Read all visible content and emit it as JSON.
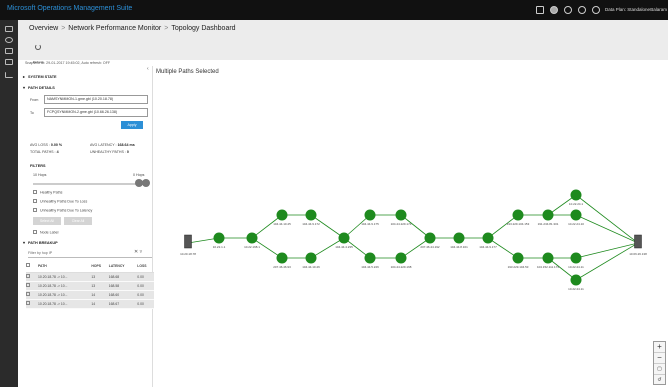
{
  "app": {
    "title": "Microsoft Operations Management Suite",
    "data_source": "Data Plan: Standalone",
    "user": "Balaram"
  },
  "breadcrumb": [
    "Overview",
    "Network Performance Monitor",
    "Topology Dashboard"
  ],
  "toolbar": {
    "refresh_label": "Refresh"
  },
  "snapshot_text": "Snapshot at: 29-01-2017 19:45:02, Auto refresh: OFF",
  "sections": {
    "system_state": "SYSTEM STATE",
    "path_details": "PATH DETAILS",
    "filters": "FILTERS",
    "path_breakup": "PATH BREAKUP"
  },
  "path": {
    "from_label": "From",
    "from_value": "NAMSYNMMON-1.gme.gbl (10.20.18.78)",
    "to_label": "To",
    "to_value": "FCPQSYNMMON-2.gme.gbl (10.66.26.138)",
    "apply": "Apply"
  },
  "stats": {
    "avg_loss_label": "AVG LOSS :",
    "avg_loss": "0.00 %",
    "avg_latency_label": "AVG LATENCY :",
    "avg_latency": "168.64 ms",
    "total_paths_label": "TOTAL PATHS :",
    "total_paths": "4",
    "unhealthy_label": "UNHEALTHY PATHS :",
    "unhealthy": "0"
  },
  "filters": {
    "hops_min": "10 Hops",
    "hops_max": "0 Hops",
    "options": [
      "Healthy Paths",
      "Unhealthy Paths Due To Loss",
      "Unhealthy Paths Due To Latency"
    ],
    "btn_left": "Select All",
    "btn_right": "Clear All",
    "node_label": "Node Label"
  },
  "breakup": {
    "filter_placeholder": "Filter by hop IP",
    "columns": [
      "PATH",
      "HOPS",
      "LATENCY",
      "LOSS"
    ],
    "rows": [
      {
        "path": "10.20.18.78 -> 10...",
        "hops": "13",
        "latency": "168.68",
        "loss": "0.00"
      },
      {
        "path": "10.20.18.78 -> 10...",
        "hops": "13",
        "latency": "168.58",
        "loss": "0.00"
      },
      {
        "path": "10.20.18.78 -> 10...",
        "hops": "14",
        "latency": "168.60",
        "loss": "0.00"
      },
      {
        "path": "10.20.18.78 -> 10...",
        "hops": "14",
        "latency": "168.67",
        "loss": "0.00"
      }
    ]
  },
  "canvas": {
    "title": "Multiple Paths Selected"
  },
  "topology": {
    "source": {
      "label": "10.20.18.78"
    },
    "dest": {
      "label": "10.66.26.138"
    },
    "nodes": [
      {
        "id": "n1",
        "label": "10.22.1.1"
      },
      {
        "id": "n2",
        "label": "10.22.168.1"
      },
      {
        "id": "n3",
        "label": "104.44.10.45"
      },
      {
        "id": "n4",
        "label": "104.44.9.172"
      },
      {
        "id": "n5",
        "label": "207.46.46.93"
      },
      {
        "id": "n6",
        "label": "104.44.10.46"
      },
      {
        "id": "n7",
        "label": "104.44.4.235"
      },
      {
        "id": "n8",
        "label": "104.44.9.175"
      },
      {
        "id": "n9",
        "label": "104.44.229.174"
      },
      {
        "id": "n10",
        "label": "104.44.5.246"
      },
      {
        "id": "n11",
        "label": "104.44.229.168"
      },
      {
        "id": "n12",
        "label": "207.46.44.192"
      },
      {
        "id": "n13",
        "label": "104.44.8.161"
      },
      {
        "id": "n14",
        "label": "104.44.9.177"
      },
      {
        "id": "n15",
        "label": "193.229.104.153"
      },
      {
        "id": "n16",
        "label": "191.234.81.301"
      },
      {
        "id": "n17",
        "label": "193.229.104.53"
      },
      {
        "id": "n18",
        "label": "104.152.111.174"
      },
      {
        "id": "n19",
        "label": "10.22.24.1"
      },
      {
        "id": "n20",
        "label": "10.22.24.10"
      },
      {
        "id": "n21",
        "label": "10.22.24.11"
      },
      {
        "id": "n22",
        "label": "10.22.24.11"
      }
    ],
    "edges": [
      [
        "src",
        "n1"
      ],
      [
        "n1",
        "n2"
      ],
      [
        "n2",
        "n3"
      ],
      [
        "n2",
        "n5"
      ],
      [
        "n3",
        "n4"
      ],
      [
        "n5",
        "n6"
      ],
      [
        "n4",
        "n7"
      ],
      [
        "n6",
        "n7"
      ],
      [
        "n7",
        "n8"
      ],
      [
        "n7",
        "n10"
      ],
      [
        "n8",
        "n9"
      ],
      [
        "n10",
        "n11"
      ],
      [
        "n9",
        "n12"
      ],
      [
        "n11",
        "n12"
      ],
      [
        "n12",
        "n13"
      ],
      [
        "n13",
        "n14"
      ],
      [
        "n14",
        "n15"
      ],
      [
        "n14",
        "n17"
      ],
      [
        "n15",
        "n16"
      ],
      [
        "n17",
        "n18"
      ],
      [
        "n16",
        "n19"
      ],
      [
        "n16",
        "n20"
      ],
      [
        "n18",
        "n21"
      ],
      [
        "n18",
        "n22"
      ],
      [
        "n19",
        "dst"
      ],
      [
        "n20",
        "dst"
      ],
      [
        "n21",
        "dst"
      ],
      [
        "n22",
        "dst"
      ]
    ]
  },
  "colors": {
    "accent": "#2c8fd6",
    "node_green": "#1e8a1e",
    "topbar": "#111111",
    "rail": "#2b2b2b"
  }
}
